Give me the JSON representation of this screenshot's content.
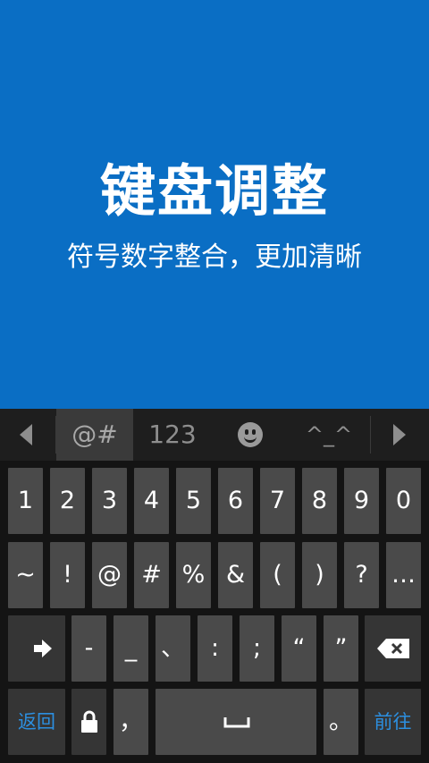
{
  "banner": {
    "title": "键盘调整",
    "subtitle": "符号数字整合，更加清晰",
    "bg_color": "#0a6ec4"
  },
  "candidate_bar": {
    "left_arrow_icon": "triangle-left-icon",
    "tabs": [
      {
        "label": "@#",
        "selected": true
      },
      {
        "label": "123",
        "selected": false
      },
      {
        "label": "emoji",
        "icon": "smiley-icon",
        "selected": false
      },
      {
        "label": "^_^",
        "selected": false
      }
    ],
    "right_arrow_icon": "triangle-right-icon"
  },
  "keyboard": {
    "row1": [
      "1",
      "2",
      "3",
      "4",
      "5",
      "6",
      "7",
      "8",
      "9",
      "0"
    ],
    "row2": [
      "~",
      "!",
      "@",
      "#",
      "%",
      "&",
      "(",
      ")",
      "?",
      "…"
    ],
    "row3": {
      "shift_icon": "arrow-right-icon",
      "keys": [
        "-",
        "_",
        "、",
        ":",
        ";",
        "“",
        "”"
      ],
      "backspace_icon": "backspace-icon"
    },
    "row4": {
      "back_label": "返回",
      "lock_icon": "lock-icon",
      "comma": "，",
      "space_icon": "space-icon",
      "period": "。",
      "forward_label": "前往"
    },
    "accent_color": "#2c8fe0"
  }
}
